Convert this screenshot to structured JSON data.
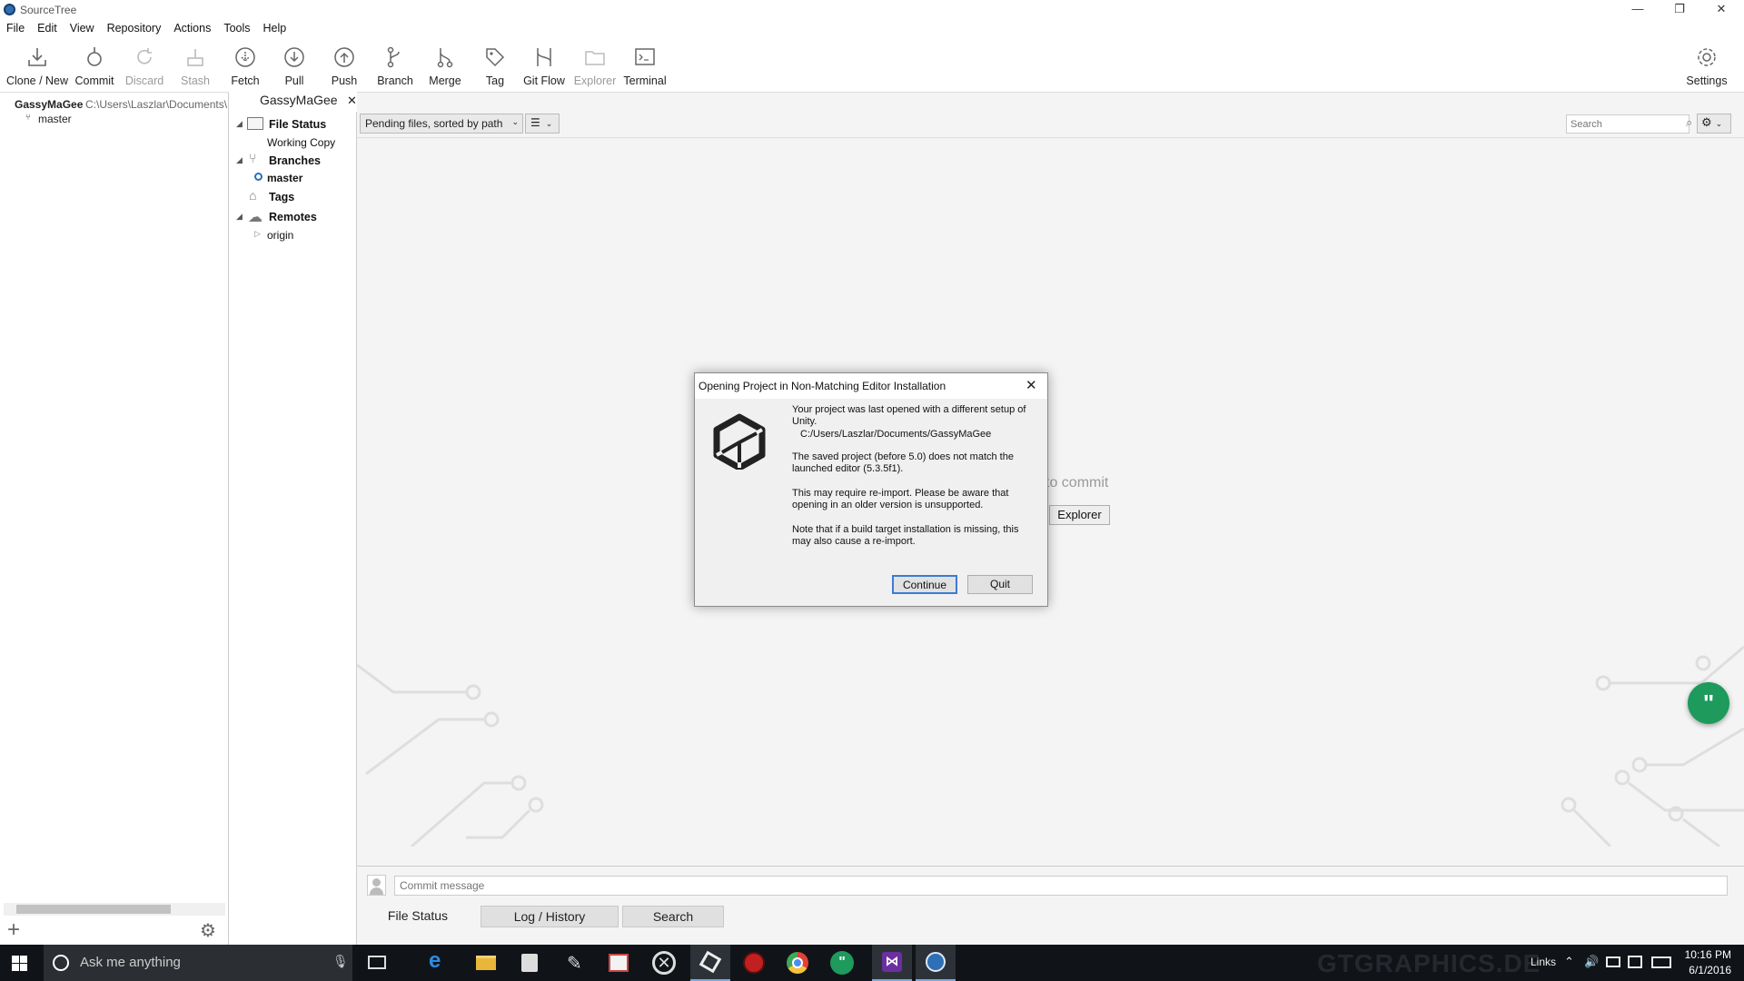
{
  "window": {
    "title": "SourceTree",
    "minimize": "—",
    "maximize": "❐",
    "close": "✕"
  },
  "menu": [
    "File",
    "Edit",
    "View",
    "Repository",
    "Actions",
    "Tools",
    "Help"
  ],
  "toolbar": {
    "clone": "Clone / New",
    "commit": "Commit",
    "discard": "Discard",
    "stash": "Stash",
    "fetch": "Fetch",
    "pull": "Pull",
    "push": "Push",
    "branch": "Branch",
    "merge": "Merge",
    "tag": "Tag",
    "gitflow": "Git Flow",
    "explorer": "Explorer",
    "terminal": "Terminal",
    "settings": "Settings"
  },
  "repos": {
    "name": "GassyMaGee",
    "path": "C:\\Users\\Laszlar\\Documents\\",
    "branch": "master"
  },
  "tab": {
    "label": "GassyMaGee",
    "close": "✕"
  },
  "sidebar": {
    "file_status": "File Status",
    "working_copy": "Working Copy",
    "branches": "Branches",
    "master": "master",
    "tags": "Tags",
    "remotes": "Remotes",
    "origin": "origin"
  },
  "filter": {
    "dropdown": "Pending files, sorted by path",
    "search_placeholder": "Search"
  },
  "background_hint": {
    "nothing": "to commit",
    "explorer_btn": "Explorer"
  },
  "dialog": {
    "title": "Opening Project in Non-Matching Editor Installation",
    "p1": "Your project was last opened with a different setup of Unity.",
    "path": "C:/Users/Laszlar/Documents/GassyMaGee",
    "p2": "The saved project (before 5.0) does not match the launched editor (5.3.5f1).",
    "p3": "This may require re-import. Please be aware that opening in an older version is unsupported.",
    "p4": "Note that if a build target installation is missing, this may also cause a re-import.",
    "continue": "Continue",
    "quit": "Quit"
  },
  "commit": {
    "placeholder": "Commit message"
  },
  "bottom_tabs": [
    "File Status",
    "Log / History",
    "Search"
  ],
  "taskbar": {
    "search_placeholder": "Ask me anything",
    "links": "Links",
    "time": "10:16 PM",
    "date": "6/1/2016",
    "watermark": "GTGRAPHICS.DE"
  },
  "colors": {
    "accent_green": "#1d9a5c",
    "unity_dark": "#222222",
    "taskbar": "#101418"
  }
}
